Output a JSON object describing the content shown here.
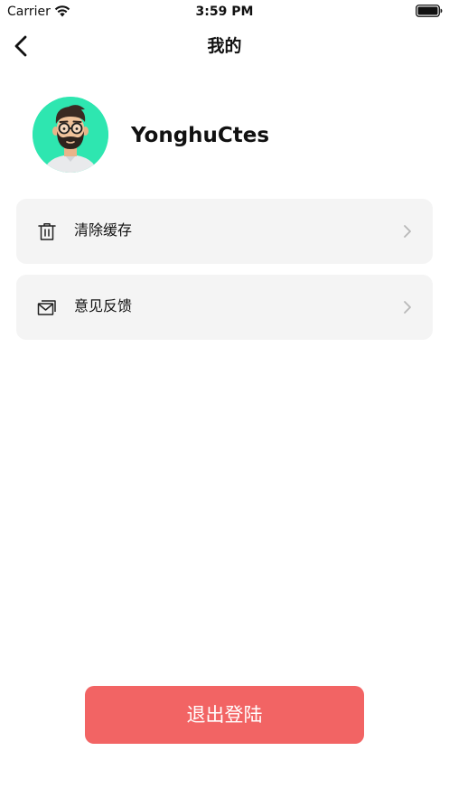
{
  "status_bar": {
    "carrier": "Carrier",
    "time": "3:59 PM",
    "icons": [
      "wifi-icon",
      "battery-icon"
    ]
  },
  "nav": {
    "title": "我的",
    "back_icon": "chevron-left-icon"
  },
  "profile": {
    "username": "YonghuCtes",
    "avatar_icon": "bearded-man-avatar",
    "avatar_bg": "#2ee6b0"
  },
  "menu": [
    {
      "label": "清除缓存",
      "icon": "trash-icon",
      "trailing_icon": "chevron-right-icon"
    },
    {
      "label": "意见反馈",
      "icon": "mail-icon",
      "trailing_icon": "chevron-right-icon"
    }
  ],
  "logout": {
    "label": "退出登陆",
    "color": "#f26464"
  },
  "colors": {
    "card_bg": "#f4f4f4",
    "text": "#111111",
    "chevron": "#b8b8b8"
  }
}
